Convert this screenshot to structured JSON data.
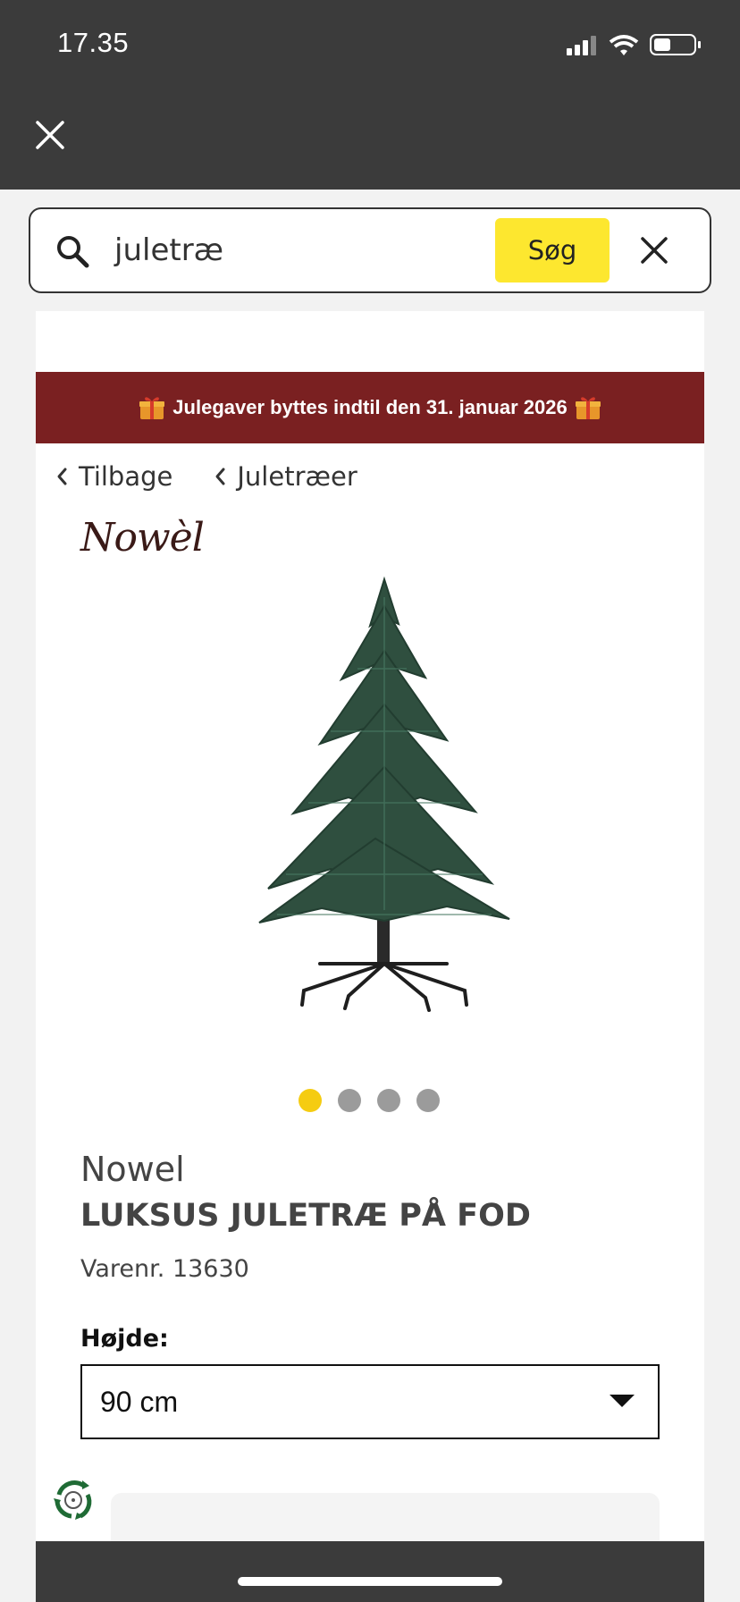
{
  "status_bar": {
    "time": "17.35"
  },
  "search": {
    "query": "juletræ",
    "button_label": "Søg"
  },
  "banner": {
    "text": "Julegaver byttes indtil den 31. januar 2026"
  },
  "breadcrumbs": [
    {
      "label": "Tilbage"
    },
    {
      "label": "Juletræer"
    }
  ],
  "brand_logo_text": "Nowèl",
  "product": {
    "brand": "Nowel",
    "title": "LUKSUS JULETRÆ PÅ FOD",
    "sku": "Varenr. 13630"
  },
  "carousel": {
    "count": 4,
    "active_index": 0
  },
  "height_selector": {
    "label": "Højde:",
    "selected": "90 cm"
  },
  "colors": {
    "banner": "#7a2021",
    "accent_yellow": "#fde72f",
    "topbar": "#3b3b3b"
  }
}
